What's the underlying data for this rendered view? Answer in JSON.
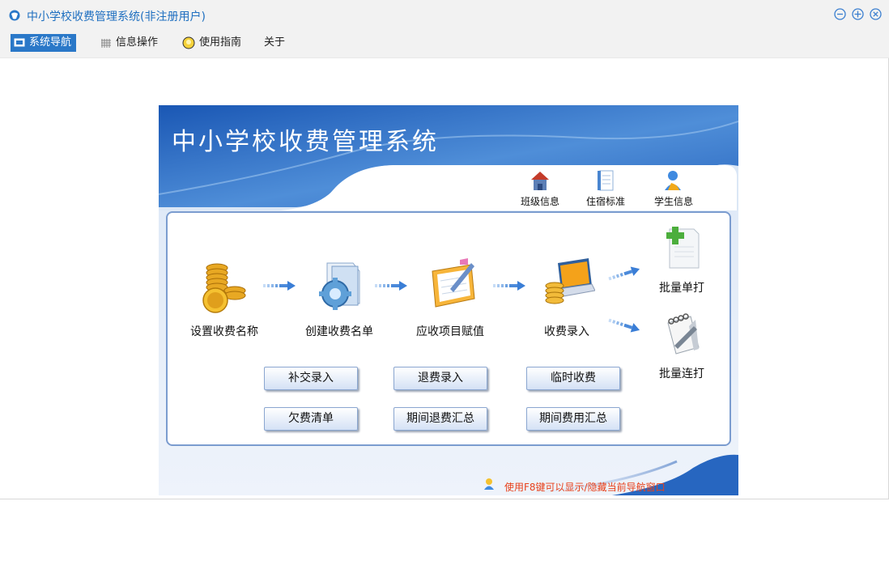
{
  "window": {
    "title": "中小学校收费管理系统(非注册用户)",
    "controls": [
      "minimize-icon",
      "maximize-icon",
      "close-icon"
    ]
  },
  "menu": {
    "items": [
      {
        "label": "系统导航",
        "icon": "monitor-icon",
        "active": true
      },
      {
        "label": "信息操作",
        "icon": "grid-icon",
        "active": false
      },
      {
        "label": "使用指南",
        "icon": "lightbulb-icon",
        "active": false
      },
      {
        "label": "关于",
        "icon": "",
        "active": false
      }
    ]
  },
  "panel": {
    "title": "中小学校收费管理系统",
    "quick_links": [
      {
        "label": "班级信息",
        "icon": "house-icon"
      },
      {
        "label": "住宿标准",
        "icon": "document-icon"
      },
      {
        "label": "学生信息",
        "icon": "user-icon"
      }
    ],
    "flow": [
      {
        "label": "设置收费名称",
        "icon": "coins-icon"
      },
      {
        "label": "创建收费名单",
        "icon": "gear-folder-icon"
      },
      {
        "label": "应收项目赋值",
        "icon": "clipboard-icon"
      },
      {
        "label": "收费录入",
        "icon": "laptop-coins-icon"
      }
    ],
    "print": [
      {
        "label": "批量单打",
        "icon": "add-document-icon"
      },
      {
        "label": "批量连打",
        "icon": "notepad-icon"
      }
    ],
    "buttons": [
      {
        "label": "补交录入"
      },
      {
        "label": "退费录入"
      },
      {
        "label": "临时收费"
      },
      {
        "label": "欠费清单"
      },
      {
        "label": "期间退费汇总"
      },
      {
        "label": "期间费用汇总"
      }
    ],
    "tip": "使用F8键可以显示/隐藏当前导航窗口"
  },
  "colors": {
    "accent": "#2a78c8",
    "banner_dark": "#1a57b4",
    "banner_light": "#5b97dc",
    "tip": "#e8401a"
  }
}
